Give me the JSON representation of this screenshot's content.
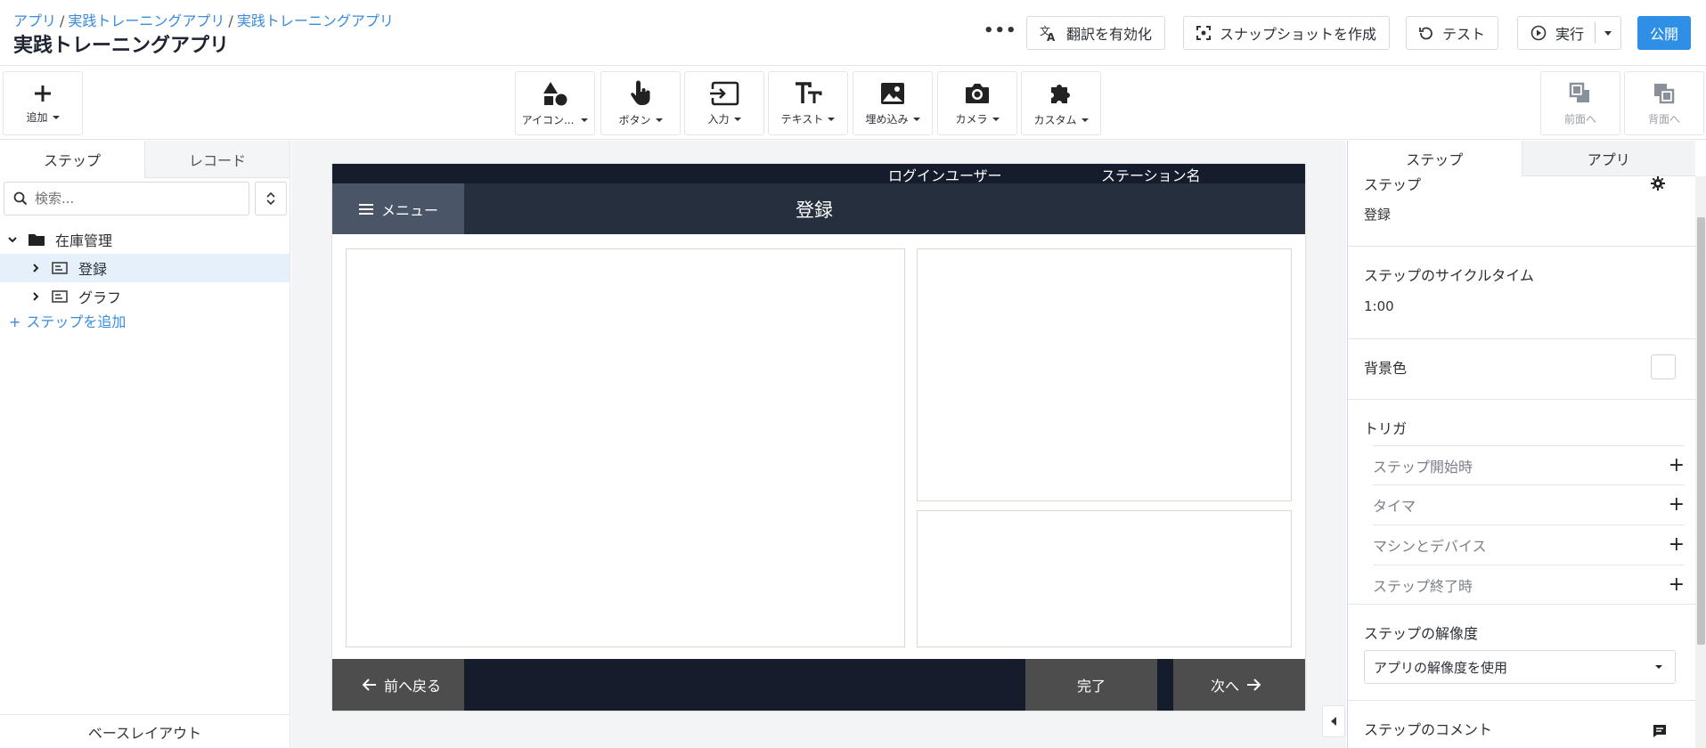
{
  "header": {
    "breadcrumb": [
      "アプリ",
      "実践トレーニングアプリ",
      "実践トレーニングアプリ"
    ],
    "app_title": "実践トレーニングアプリ",
    "more_label": "•••",
    "translate_label": "翻訳を有効化",
    "snapshot_label": "スナップショットを作成",
    "test_label": "テスト",
    "run_label": "実行",
    "publish_label": "公開"
  },
  "toolbar": {
    "add_label": "追加",
    "tools": [
      {
        "label": "アイコン..."
      },
      {
        "label": "ボタン"
      },
      {
        "label": "入力"
      },
      {
        "label": "テキスト"
      },
      {
        "label": "埋め込み"
      },
      {
        "label": "カメラ"
      },
      {
        "label": "カスタム"
      }
    ],
    "front_label": "前面へ",
    "back_label": "背面へ"
  },
  "left": {
    "tabs": [
      "ステップ",
      "レコード"
    ],
    "search_placeholder": "検索...",
    "folder": "在庫管理",
    "steps": [
      "登録",
      "グラフ"
    ],
    "add_step": "ステップを追加",
    "base_layout": "ベースレイアウト"
  },
  "canvas": {
    "topbar_user": "ログインユーザー",
    "topbar_station": "ステーション名",
    "menu_label": "メニュー",
    "step_title": "登録",
    "back_label": "前へ戻る",
    "complete_label": "完了",
    "next_label": "次へ"
  },
  "right": {
    "tabs": [
      "ステップ",
      "アプリ"
    ],
    "step_label": "ステップ",
    "step_value": "登録",
    "cycle_label": "ステップのサイクルタイム",
    "cycle_value": "1:00",
    "bg_label": "背景色",
    "trigger_label": "トリガ",
    "triggers": [
      "ステップ開始時",
      "タイマ",
      "マシンとデバイス",
      "ステップ終了時"
    ],
    "resolution_label": "ステップの解像度",
    "resolution_value": "アプリの解像度を使用",
    "comment_label": "ステップのコメント"
  },
  "colors": {
    "accent": "#2f8fe6",
    "link": "#3a8bdc",
    "dark_bar": "#151d2c",
    "nav_bar": "#252f3e",
    "selected_row": "#e6f0fb"
  }
}
